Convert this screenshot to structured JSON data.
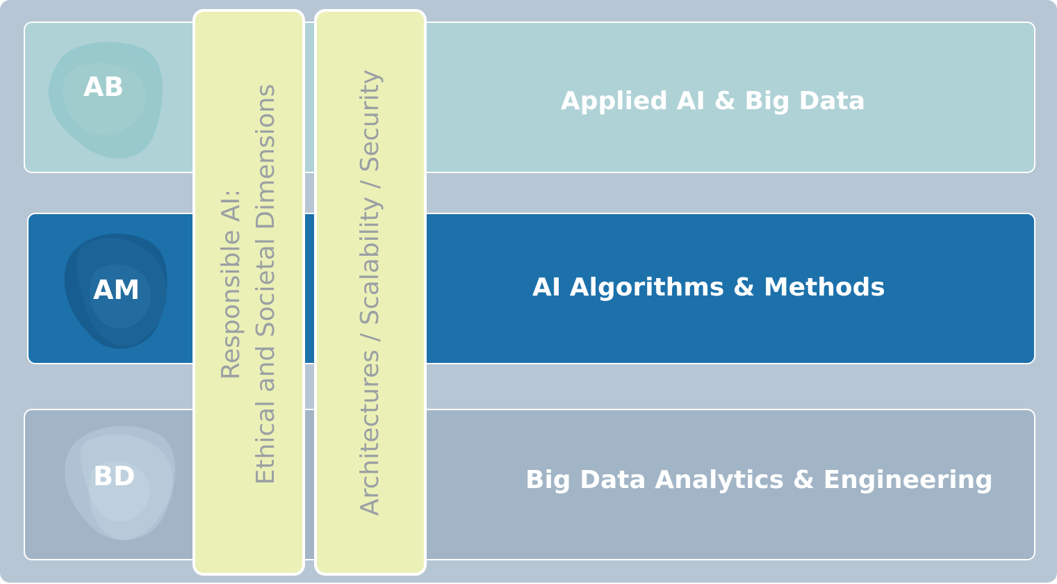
{
  "rows": [
    {
      "abbr": "AB",
      "title": "Applied AI & Big Data",
      "color": "#afd2d6"
    },
    {
      "abbr": "AM",
      "title": "AI Algorithms & Methods",
      "color": "#1c71ab"
    },
    {
      "abbr": "BD",
      "title": "Big Data Analytics & Engineering",
      "color": "#a2b5c6"
    }
  ],
  "pillars": [
    {
      "line1": "Responsible AI:",
      "line2": "Ethical and Societal Dimensions"
    },
    {
      "line1": "Architectures / Scalability / Security"
    }
  ],
  "colors": {
    "background": "#b7c6d4",
    "pillar": "#ebf0b7",
    "pillar_text": "#9aa0a3",
    "text": "#ffffff"
  }
}
